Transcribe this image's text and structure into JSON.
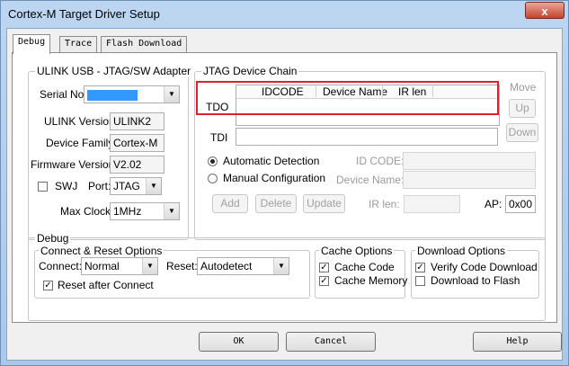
{
  "window": {
    "title": "Cortex-M Target Driver Setup",
    "close_glyph": "x"
  },
  "tabs": [
    "Debug",
    "Trace",
    "Flash Download"
  ],
  "ulink": {
    "title": "ULINK USB - JTAG/SW Adapter",
    "serial_label": "Serial No:",
    "serial_value": "",
    "version_label": "ULINK Version:",
    "version_value": "ULINK2",
    "family_label": "Device Family:",
    "family_value": "Cortex-M",
    "firmware_label": "Firmware Version:",
    "firmware_value": "V2.02",
    "swj_label": "SWJ",
    "port_label": "Port:",
    "port_value": "JTAG",
    "maxclock_label": "Max Clock:",
    "maxclock_value": "1MHz"
  },
  "jtag": {
    "title": "JTAG Device Chain",
    "columns": [
      "IDCODE",
      "Device Name",
      "IR len"
    ],
    "tdo": "TDO",
    "tdi": "TDI",
    "move_label": "Move",
    "up": "Up",
    "down": "Down",
    "auto_detect": "Automatic Detection",
    "manual_config": "Manual Configuration",
    "idcode_label": "ID CODE:",
    "devname_label": "Device Name:",
    "add": "Add",
    "delete": "Delete",
    "update": "Update",
    "irlen_label": "IR len:",
    "ap_label": "AP:",
    "ap_value": "0x00"
  },
  "debug": {
    "title": "Debug",
    "connect_group": "Connect & Reset Options",
    "connect_label": "Connect:",
    "connect_value": "Normal",
    "reset_label": "Reset:",
    "reset_value": "Autodetect",
    "reset_after_connect": "Reset after Connect",
    "cache_group": "Cache Options",
    "cache_code": "Cache Code",
    "cache_memory": "Cache Memory",
    "download_group": "Download Options",
    "verify_download": "Verify Code Download",
    "download_flash": "Download to Flash"
  },
  "buttons": {
    "ok": "OK",
    "cancel": "Cancel",
    "help": "Help"
  },
  "colors": {
    "highlight_box": "#e0202c",
    "selection": "#3399ff"
  }
}
